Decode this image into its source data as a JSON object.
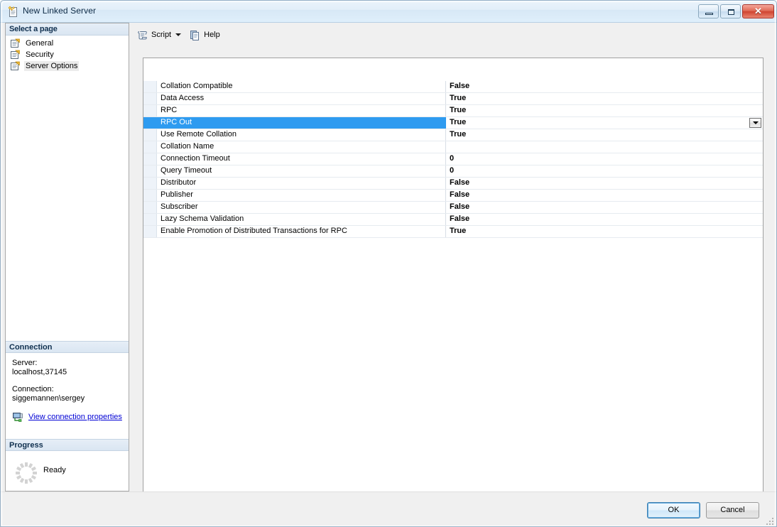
{
  "window": {
    "title": "New Linked Server",
    "icon": "linked-server-icon",
    "controls": {
      "minimize": "Minimize",
      "maximize": "Maximize",
      "close": "Close"
    }
  },
  "sidebar": {
    "header": "Select a page",
    "items": [
      {
        "label": "General",
        "selected": false
      },
      {
        "label": "Security",
        "selected": false
      },
      {
        "label": "Server Options",
        "selected": true
      }
    ]
  },
  "connection": {
    "header": "Connection",
    "server_label": "Server:",
    "server_value": "localhost,37145",
    "connection_label": "Connection:",
    "connection_value": "siggemannen\\sergey",
    "link": "View connection properties",
    "link_icon": "connection-properties-icon"
  },
  "progress": {
    "header": "Progress",
    "status": "Ready",
    "spinner_icon": "progress-spinner-icon"
  },
  "toolbar": {
    "script": {
      "label": "Script",
      "icon": "script-scroll-icon",
      "caret_icon": "chevron-down-icon"
    },
    "help": {
      "label": "Help",
      "icon": "help-page-icon"
    }
  },
  "properties": {
    "dropdown_icon": "chevron-down-icon",
    "rows": [
      {
        "name": "Collation Compatible",
        "value": "False",
        "selected": false
      },
      {
        "name": "Data Access",
        "value": "True",
        "selected": false
      },
      {
        "name": "RPC",
        "value": "True",
        "selected": false
      },
      {
        "name": "RPC Out",
        "value": "True",
        "selected": true
      },
      {
        "name": "Use Remote Collation",
        "value": "True",
        "selected": false
      },
      {
        "name": "Collation Name",
        "value": "",
        "selected": false
      },
      {
        "name": "Connection Timeout",
        "value": "0",
        "selected": false
      },
      {
        "name": "Query Timeout",
        "value": "0",
        "selected": false
      },
      {
        "name": "Distributor",
        "value": "False",
        "selected": false
      },
      {
        "name": "Publisher",
        "value": "False",
        "selected": false
      },
      {
        "name": "Subscriber",
        "value": "False",
        "selected": false
      },
      {
        "name": "Lazy Schema Validation",
        "value": "False",
        "selected": false
      },
      {
        "name": "Enable Promotion of Distributed Transactions for RPC",
        "value": "True",
        "selected": false
      }
    ]
  },
  "footer": {
    "ok": "OK",
    "cancel": "Cancel"
  },
  "colors": {
    "selection": "#2e9bf0",
    "link": "#0000d4",
    "header_text": "#10304f",
    "close_button": "#cf4430"
  }
}
